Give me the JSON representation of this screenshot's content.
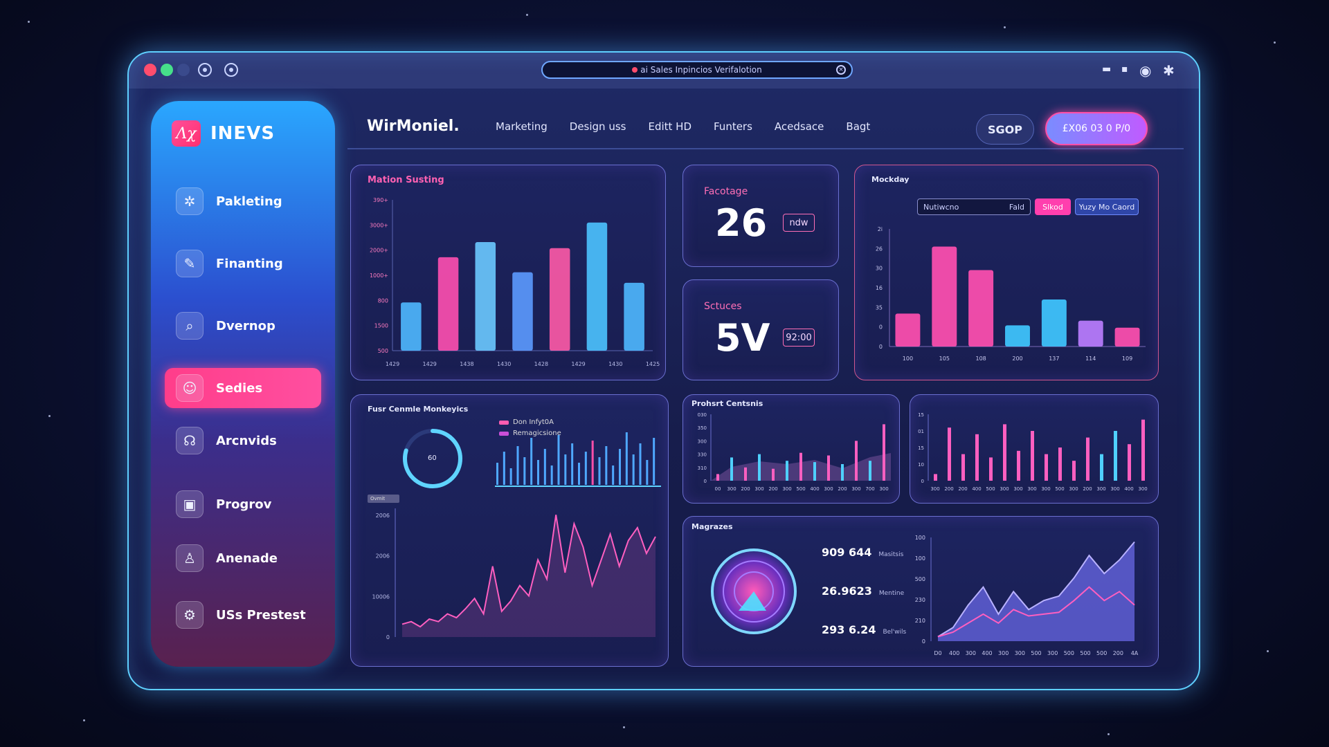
{
  "window": {
    "address_bar": "ai Sales Inpincios Verifalotion"
  },
  "sidebar": {
    "brand_name": "INEVS",
    "brand_logo": "Λχ",
    "items": [
      {
        "label": "Pakleting",
        "icon": "settings-icon",
        "active": false
      },
      {
        "label": "Finanting",
        "icon": "edit-icon",
        "active": false
      },
      {
        "label": "Dvernop",
        "icon": "search-icon",
        "active": false
      },
      {
        "label": "Sedies",
        "icon": "user-icon",
        "active": true
      },
      {
        "label": "Arcnvids",
        "icon": "headset-icon",
        "active": false
      },
      {
        "label": "Progrov",
        "icon": "presentation-icon",
        "active": false
      },
      {
        "label": "Anenade",
        "icon": "person-icon",
        "active": false
      },
      {
        "label": "USs Prestest",
        "icon": "gear-icon",
        "active": false
      }
    ]
  },
  "header": {
    "app_title": "WirMoniel.",
    "nav": [
      "Marketing",
      "Design uss",
      "Editt HD",
      "Funters",
      "Acedsace",
      "Bagt"
    ],
    "button_secondary": "SGOP",
    "button_primary": "£X06 03 0 P/0"
  },
  "panels": {
    "motion": {
      "title": "Mation Susting"
    },
    "stat1": {
      "label": "Facotage",
      "value": "26",
      "chip": "ndw"
    },
    "stat2": {
      "label": "Sctuces",
      "value": "5V",
      "chip": "92:00"
    },
    "mockday": {
      "title": "Mockday",
      "input_value": "Nutiwcno",
      "input_tag": "Fald",
      "pink_tag": "Slkod",
      "blue_tag": "Yuzy Mo Caord"
    },
    "fusr": {
      "title": "Fusr Cenmle Monkeyics",
      "ring_label": "60",
      "legend": [
        "Don Infyt0A",
        "Remagicsione"
      ],
      "small_tag": "Ovmit"
    },
    "product": {
      "title": "Prohsrt Centsnis"
    },
    "magrazes": {
      "title": "Magrazes",
      "metrics": [
        {
          "value": "909 644",
          "note": "Masitsis"
        },
        {
          "value": "26.9623",
          "note": "Mentine"
        },
        {
          "value": "293 6.24",
          "note": "Bel'wils"
        }
      ]
    }
  },
  "chart_data": [
    {
      "type": "bar",
      "title": "Mation Susting",
      "ylabel_ticks": [
        "390+",
        "3000+",
        "2000+",
        "1000+",
        "800",
        "1500",
        "500"
      ],
      "categories": [
        "1429",
        "1429",
        "1438",
        "1430",
        "1428",
        "1429",
        "1430",
        "1425"
      ],
      "values": [
        32,
        62,
        72,
        52,
        68,
        85,
        45
      ],
      "colors": [
        "#4fb8ff",
        "#ff4fb0",
        "#6cc9ff",
        "#5c9aff",
        "#ff5aa7",
        "#4dc3ff",
        "#4fb8ff"
      ]
    },
    {
      "type": "bar",
      "title": "Mockday",
      "y_ticks": [
        "2i",
        "26",
        "30",
        "16",
        "35",
        "0",
        "0"
      ],
      "categories": [
        "100",
        "105",
        "108",
        "200",
        "137",
        "114",
        "109"
      ],
      "values": [
        28,
        85,
        65,
        18,
        40,
        22,
        16
      ],
      "colors": [
        "#ff4fb0",
        "#ff4fb0",
        "#ff4fb0",
        "#3fc7ff",
        "#3fc7ff",
        "#ba7dff",
        "#ff4fb0"
      ]
    },
    {
      "type": "line",
      "title": "Fusr Cenmle Monkeyics",
      "y_ticks": [
        "2006",
        "2006",
        "10006",
        "0"
      ],
      "values": [
        10,
        12,
        8,
        14,
        12,
        18,
        15,
        22,
        30,
        18,
        55,
        20,
        28,
        40,
        32,
        60,
        45,
        95,
        50,
        88,
        70,
        40,
        60,
        80,
        55,
        75,
        85,
        65,
        78
      ]
    },
    {
      "type": "bar",
      "title": "Prohsrt Centsnis",
      "y_ticks": [
        "030",
        "350",
        "300",
        "330",
        "310",
        "0"
      ],
      "categories": [
        "00",
        "300",
        "200",
        "300",
        "200",
        "300",
        "500",
        "400",
        "300",
        "200",
        "300",
        "700",
        "300"
      ],
      "values": [
        10,
        35,
        20,
        40,
        18,
        30,
        42,
        28,
        38,
        25,
        60,
        30,
        85
      ]
    },
    {
      "type": "bar",
      "title": "",
      "y_ticks": [
        "15",
        "01",
        "15",
        "10",
        "0"
      ],
      "categories": [
        "300",
        "200",
        "200",
        "400",
        "500",
        "300",
        "300",
        "300",
        "300",
        "500",
        "300",
        "200",
        "300",
        "300",
        "400",
        "300"
      ],
      "values": [
        10,
        80,
        40,
        70,
        35,
        85,
        45,
        75,
        40,
        50,
        30,
        65,
        40,
        75,
        55,
        92
      ]
    },
    {
      "type": "area",
      "title": "Magrazes",
      "y_ticks": [
        "100",
        "100",
        "500",
        "230",
        "210",
        "0"
      ],
      "categories": [
        "D0",
        "400",
        "300",
        "400",
        "300",
        "300",
        "500",
        "300",
        "500",
        "500",
        "500",
        "200",
        "4A"
      ],
      "series": [
        {
          "values": [
            5,
            15,
            40,
            60,
            30,
            55,
            35,
            45,
            50,
            70,
            95,
            75,
            90,
            110
          ]
        },
        {
          "values": [
            5,
            10,
            20,
            30,
            20,
            35,
            28,
            30,
            32,
            45,
            60,
            45,
            55,
            40
          ]
        }
      ]
    }
  ]
}
